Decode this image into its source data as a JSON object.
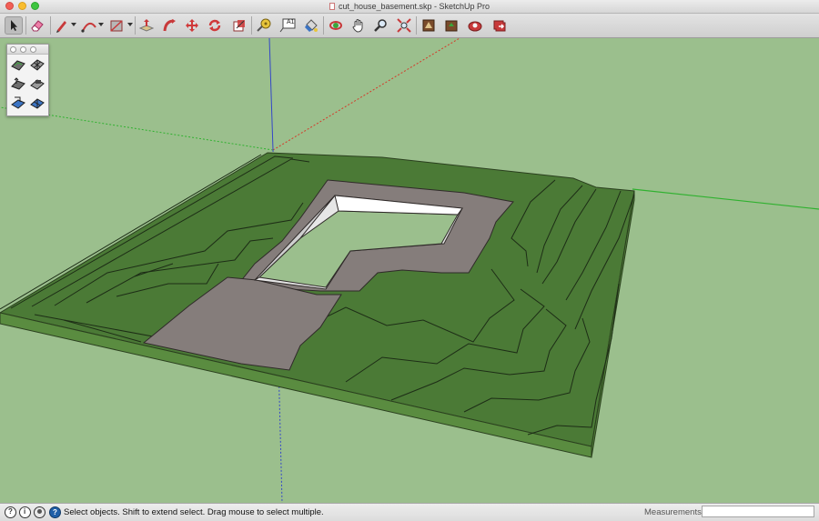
{
  "window": {
    "title": "cut_house_basement.skp - SketchUp Pro"
  },
  "toolbar": {
    "tools": [
      {
        "name": "select-tool",
        "icon": "arrow-cursor-icon",
        "active": true
      },
      {
        "name": "eraser-tool",
        "icon": "eraser-icon"
      },
      {
        "name": "line-tool",
        "icon": "pencil-icon",
        "dropdown": true
      },
      {
        "name": "arc-tool",
        "icon": "arc-icon",
        "dropdown": true
      },
      {
        "name": "rectangle-tool",
        "icon": "rectangle-icon",
        "dropdown": true
      },
      {
        "name": "push-pull-tool",
        "icon": "push-pull-icon"
      },
      {
        "name": "follow-me-tool",
        "icon": "follow-me-icon"
      },
      {
        "name": "move-tool",
        "icon": "move-icon"
      },
      {
        "name": "rotate-tool",
        "icon": "rotate-icon"
      },
      {
        "name": "scale-tool",
        "icon": "scale-icon"
      },
      {
        "name": "tape-measure-tool",
        "icon": "tape-measure-icon"
      },
      {
        "name": "text-tool",
        "icon": "text-icon"
      },
      {
        "name": "paint-bucket-tool",
        "icon": "paint-bucket-icon"
      },
      {
        "name": "orbit-tool",
        "icon": "orbit-icon"
      },
      {
        "name": "pan-tool",
        "icon": "hand-icon"
      },
      {
        "name": "zoom-tool",
        "icon": "magnifier-icon"
      },
      {
        "name": "zoom-extents-tool",
        "icon": "zoom-extents-icon"
      },
      {
        "name": "warehouse-tool",
        "icon": "3d-warehouse-icon"
      },
      {
        "name": "share-model-tool",
        "icon": "share-model-icon"
      },
      {
        "name": "extension-warehouse-tool",
        "icon": "extension-warehouse-icon"
      },
      {
        "name": "layout-tool",
        "icon": "send-to-layout-icon"
      }
    ],
    "text_tool_label": "A1"
  },
  "palette": {
    "tools": [
      {
        "name": "sandbox-from-contours",
        "icon": "from-contours-icon"
      },
      {
        "name": "sandbox-from-scratch",
        "icon": "from-scratch-icon"
      },
      {
        "name": "sandbox-smoove",
        "icon": "smoove-icon"
      },
      {
        "name": "sandbox-stamp",
        "icon": "stamp-icon"
      },
      {
        "name": "sandbox-drape",
        "icon": "drape-icon"
      },
      {
        "name": "sandbox-add-detail",
        "icon": "add-detail-icon"
      }
    ]
  },
  "status": {
    "message": "Select objects. Shift to extend select. Drag mouse to select multiple.",
    "measurements_label": "Measurements",
    "measurements_value": ""
  },
  "colors": {
    "sky_ground": "#9bbf8d",
    "terrain_green": "#4b7a36",
    "terrain_edge": "#5a8c40",
    "gravel": "#857d7b",
    "axis_red": "#d43a2a",
    "axis_green": "#2fb12f",
    "axis_blue": "#3447c8"
  }
}
